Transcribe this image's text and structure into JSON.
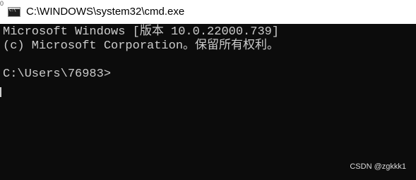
{
  "window": {
    "title": "C:\\WINDOWS\\system32\\cmd.exe",
    "edge_mark": "0"
  },
  "icons": {
    "app": "command-prompt-icon",
    "app_glyph": "C:\\"
  },
  "console": {
    "lines": [
      "Microsoft Windows [版本 10.0.22000.739]",
      "(c) Microsoft Corporation。保留所有权利。",
      "C:\\Users\\76983>"
    ],
    "text_color": "#cccccc",
    "background": "#0c0c0c"
  },
  "watermark": "CSDN @zgkkk1"
}
